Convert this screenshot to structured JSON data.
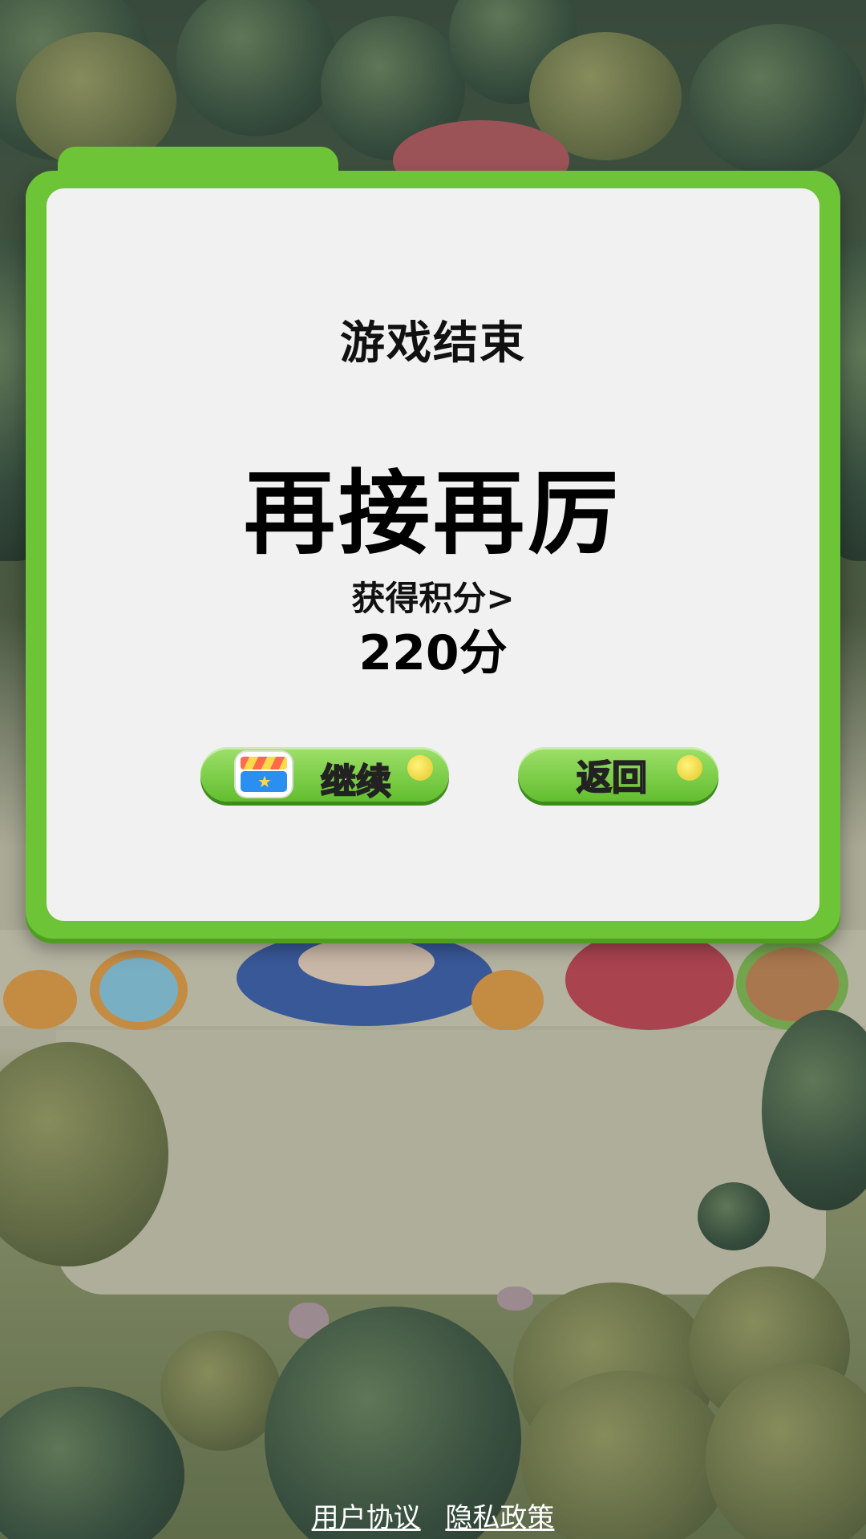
{
  "dialog": {
    "title": "游戏结束",
    "message": "再接再厉",
    "score_label": "获得积分>",
    "score_value": "220分"
  },
  "buttons": {
    "continue_label": "继续",
    "continue_icon": "clapperboard-icon",
    "back_label": "返回"
  },
  "footer": {
    "user_agreement": "用户协议",
    "privacy_policy": "隐私政策"
  },
  "colors": {
    "dialog_border": "#6cc436",
    "dialog_fill": "#f1f1f1",
    "button_green": "#62be2e",
    "coin_yellow": "#e3c52a"
  }
}
